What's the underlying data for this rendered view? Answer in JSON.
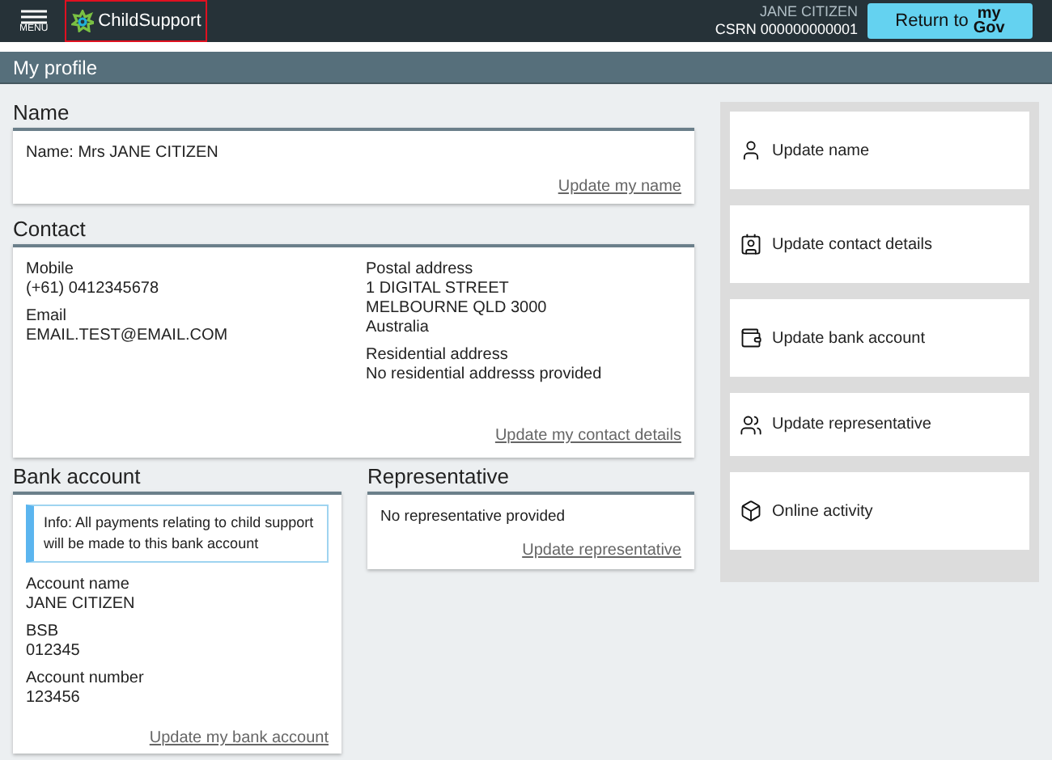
{
  "header": {
    "menu_label": "MENU",
    "logo_text": "ChildSupport",
    "user_name": "JANE CITIZEN",
    "csrn": "CSRN 000000000001",
    "return_button": {
      "label": "Return to",
      "logo_top": "my",
      "logo_bottom": "Gov"
    }
  },
  "page_title": "My profile",
  "name_section": {
    "heading": "Name",
    "text": "Name: Mrs JANE CITIZEN",
    "link": "Update my name"
  },
  "contact_section": {
    "heading": "Contact",
    "left": [
      {
        "label": "Mobile",
        "lines": [
          "(+61) 0412345678"
        ]
      },
      {
        "label": "Email",
        "lines": [
          "EMAIL.TEST@EMAIL.COM"
        ]
      }
    ],
    "right": [
      {
        "label": "Postal address",
        "lines": [
          "1 DIGITAL STREET",
          "MELBOURNE QLD 3000",
          "Australia"
        ]
      },
      {
        "label": "Residential address",
        "lines": [
          "No residential addresss provided"
        ]
      }
    ],
    "link": "Update my contact details"
  },
  "bank_section": {
    "heading": "Bank account",
    "info": "Info: All payments relating to child support will be made to this bank account",
    "fields": [
      {
        "label": "Account name",
        "lines": [
          "JANE CITIZEN"
        ]
      },
      {
        "label": "BSB",
        "lines": [
          "012345"
        ]
      },
      {
        "label": "Account number",
        "lines": [
          "123456"
        ]
      }
    ],
    "link": "Update my bank account"
  },
  "representative_section": {
    "heading": "Representative",
    "text": "No representative provided",
    "link": "Update representative"
  },
  "quick_links": [
    {
      "kind": "name",
      "label": "Update name"
    },
    {
      "kind": "contact",
      "label": "Update contact details"
    },
    {
      "kind": "bank",
      "label": "Update bank account"
    },
    {
      "kind": "representative",
      "label": "Update representative"
    },
    {
      "kind": "activity",
      "label": "Online activity"
    }
  ]
}
